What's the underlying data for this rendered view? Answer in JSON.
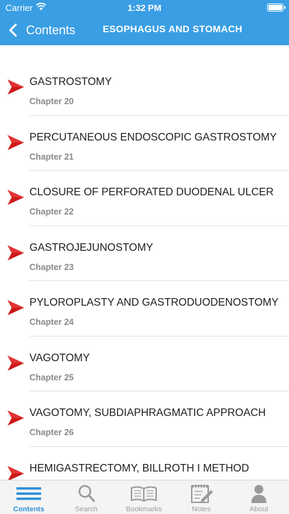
{
  "status_bar": {
    "carrier": "Carrier",
    "time": "1:32 PM"
  },
  "nav": {
    "back_label": "Contents",
    "title": "ESOPHAGUS AND STOMACH"
  },
  "chapters": [
    {
      "title": "GASTROSTOMY",
      "chapter": "Chapter 20"
    },
    {
      "title": "PERCUTANEOUS ENDOSCOPIC GASTROSTOMY",
      "chapter": "Chapter 21"
    },
    {
      "title": "CLOSURE OF PERFORATED DUODENAL ULCER",
      "chapter": "Chapter 22"
    },
    {
      "title": "GASTROJEJUNOSTOMY",
      "chapter": "Chapter 23"
    },
    {
      "title": "PYLOROPLASTY AND GASTRODUODENOSTOMY",
      "chapter": "Chapter 24"
    },
    {
      "title": "VAGOTOMY",
      "chapter": "Chapter 25"
    },
    {
      "title": "VAGOTOMY, SUBDIAPHRAGMATIC APPROACH",
      "chapter": "Chapter 26"
    },
    {
      "title": "HEMIGASTRECTOMY, BILLROTH I METHOD",
      "chapter": ""
    }
  ],
  "tabs": [
    {
      "label": "Contents",
      "icon": "menu-lines-icon",
      "active": true
    },
    {
      "label": "Search",
      "icon": "magnifier-icon",
      "active": false
    },
    {
      "label": "Bookmarks",
      "icon": "open-book-icon",
      "active": false
    },
    {
      "label": "Notes",
      "icon": "notepad-pencil-icon",
      "active": false
    },
    {
      "label": "About",
      "icon": "person-icon",
      "active": false
    }
  ],
  "colors": {
    "header": "#3a9ee4",
    "arrow": "#cc1a1a",
    "active_tab": "#2f8fd8",
    "inactive_tab": "#9a9a9a"
  }
}
